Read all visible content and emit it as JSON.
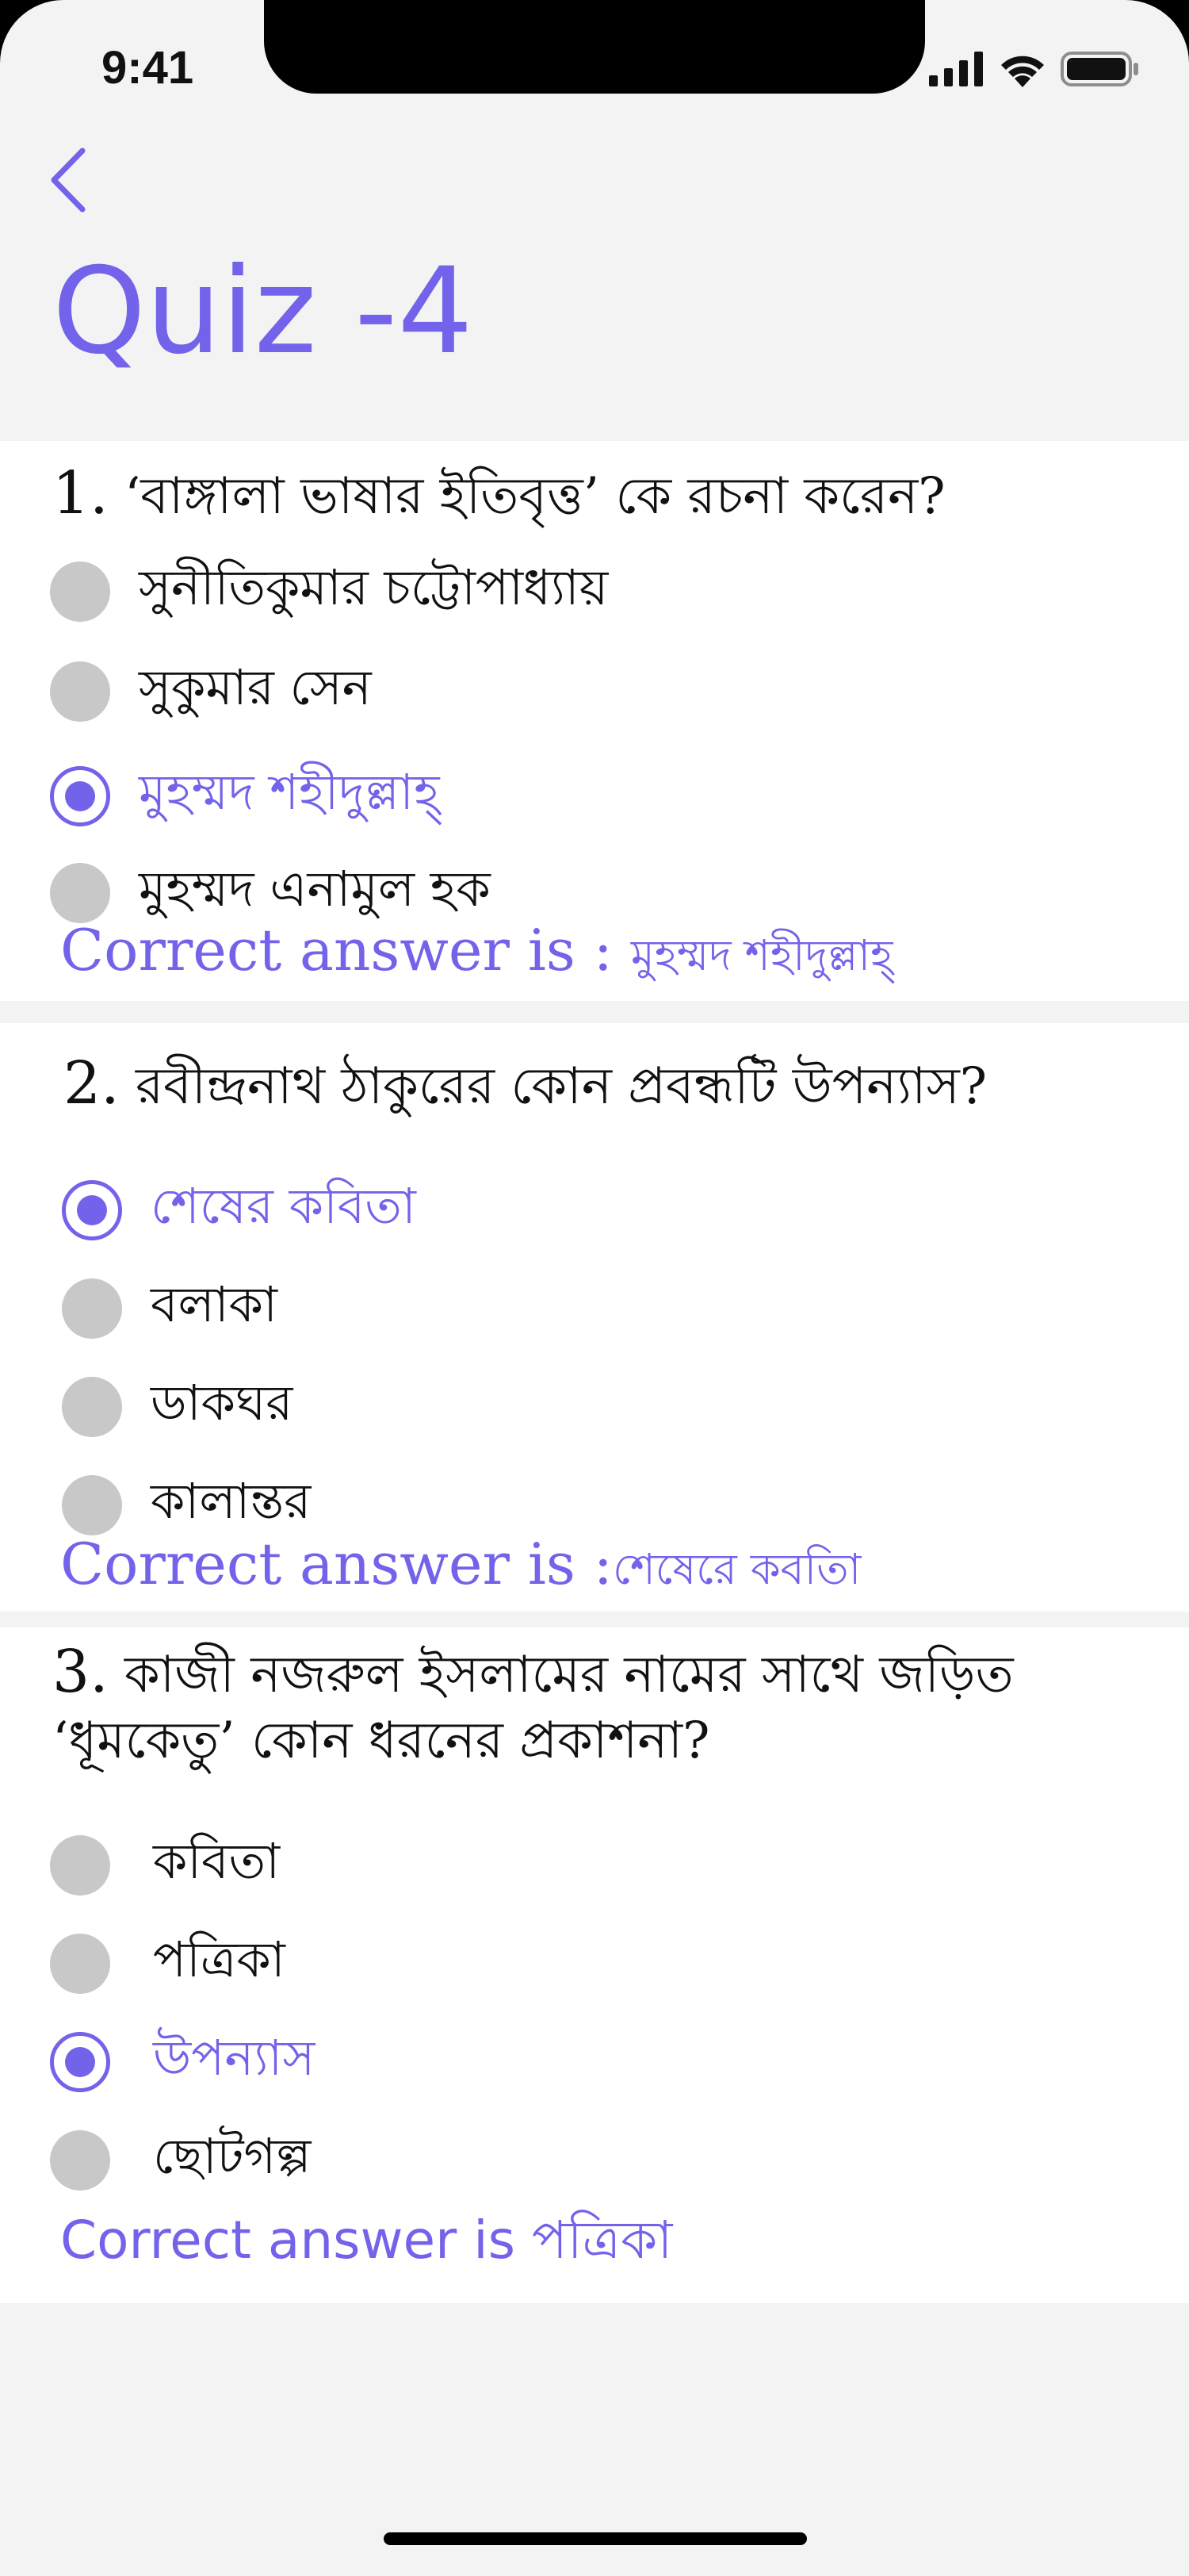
{
  "status_bar": {
    "time": "9:41"
  },
  "header": {
    "title": "Quiz -4"
  },
  "questions": [
    {
      "number": "1.",
      "text": "‘বাঙ্গালা ভাষার ইতিবৃত্ত’ কে রচনা করেন?",
      "options": [
        {
          "label": "সুনীতিকুমার চট্টোপাধ্যায়",
          "selected": false
        },
        {
          "label": "সুকুমার সেন",
          "selected": false
        },
        {
          "label": "মুহম্মদ শহীদুল্লাহ্",
          "selected": true
        },
        {
          "label": "মুহম্মদ এনামুল হক",
          "selected": false
        }
      ],
      "answer_prefix": "Correct answer is :",
      "answer_value": "মুহম্মদ শহীদুল্লাহ্"
    },
    {
      "number": "2.",
      "text": "রবীন্দ্রনাথ ঠাকুরের কোন প্রবন্ধটি উপন্যাস?",
      "options": [
        {
          "label": "শেষের কবিতা",
          "selected": true
        },
        {
          "label": "বলাকা",
          "selected": false
        },
        {
          "label": "ডাকঘর",
          "selected": false
        },
        {
          "label": "কালান্তর",
          "selected": false
        }
      ],
      "answer_prefix": "Correct answer is :",
      "answer_value": "শেষেরে কবতিা"
    },
    {
      "number": "3.",
      "text_line1": "কাজী নজরুল ইসলামের নামের সাথে জড়িত",
      "text_line2": "‘ধূমকেতু’ কোন ধরনের প্রকাশনা?",
      "options": [
        {
          "label": "কবিতা",
          "selected": false
        },
        {
          "label": "পত্রিকা",
          "selected": false
        },
        {
          "label": "উপন্যাস",
          "selected": true
        },
        {
          "label": "ছোটগল্প",
          "selected": false
        }
      ],
      "answer_prefix": "Correct answer is",
      "answer_value": "পত্রিকা"
    }
  ],
  "colors": {
    "accent": "#7363ea",
    "radio_off": "#c8c8c8",
    "background": "#f3f3f3"
  }
}
